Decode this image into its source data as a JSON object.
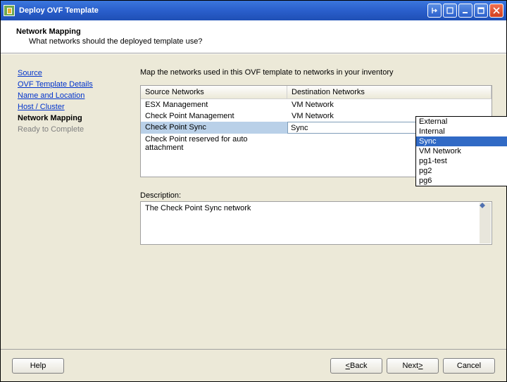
{
  "window": {
    "title": "Deploy OVF Template"
  },
  "header": {
    "title": "Network Mapping",
    "subtitle": "What networks should the deployed template use?"
  },
  "sidebar": {
    "steps": [
      {
        "label": "Source",
        "state": "link"
      },
      {
        "label": "OVF Template Details",
        "state": "link"
      },
      {
        "label": "Name and Location",
        "state": "link"
      },
      {
        "label": "Host / Cluster",
        "state": "link"
      },
      {
        "label": "Network Mapping",
        "state": "current"
      },
      {
        "label": "Ready to Complete",
        "state": "future"
      }
    ]
  },
  "main": {
    "instruction": "Map the networks used in this OVF template to networks in your inventory",
    "grid": {
      "col_source": "Source Networks",
      "col_dest": "Destination Networks",
      "rows": [
        {
          "src": "ESX Management",
          "dst": "VM Network",
          "selected": false
        },
        {
          "src": "Check Point Management",
          "dst": "VM Network",
          "selected": false
        },
        {
          "src": "Check Point Sync",
          "dst": "Sync",
          "selected": true
        },
        {
          "src": "Check Point reserved for auto attachment",
          "dst": "",
          "selected": false
        }
      ]
    },
    "dropdown": {
      "options": [
        {
          "label": "External",
          "selected": false
        },
        {
          "label": "Internal",
          "selected": false
        },
        {
          "label": "Sync",
          "selected": true
        },
        {
          "label": "VM Network",
          "selected": false
        },
        {
          "label": "pg1-test",
          "selected": false
        },
        {
          "label": "pg2",
          "selected": false
        },
        {
          "label": "pg6",
          "selected": false
        }
      ]
    },
    "description_label": "Description:",
    "description_text": "The Check Point Sync network"
  },
  "footer": {
    "help": "Help",
    "back_u": "<",
    "back_t": " Back",
    "next_t": "Next ",
    "next_u": ">",
    "cancel": "Cancel"
  }
}
